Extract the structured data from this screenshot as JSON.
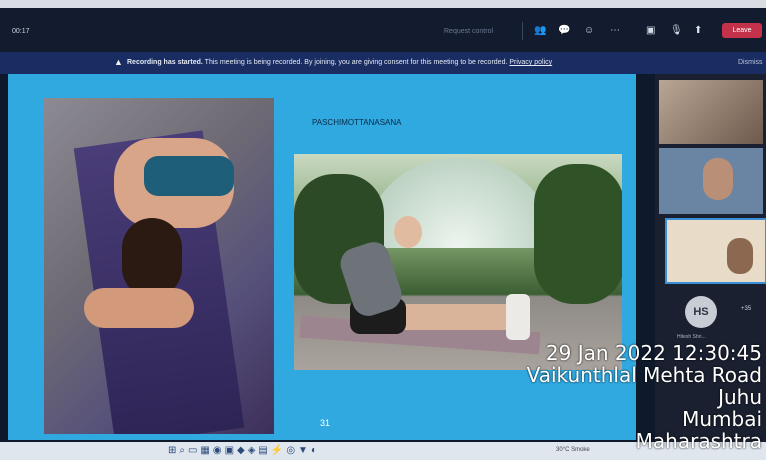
{
  "meeting": {
    "timer": "00:17",
    "request_control": "Request control",
    "leave": "Leave"
  },
  "banner": {
    "bold": "Recording has started.",
    "message": " This meeting is being recorded. By joining, you are giving consent for this meeting to be recorded. ",
    "privacy": "Privacy policy",
    "dismiss": "Dismiss"
  },
  "slide": {
    "title": "PASCHIMOTTANASANA",
    "page_number": "31"
  },
  "participants": {
    "avatar_initials": "HS",
    "avatar_name": "Hitesh Shri...",
    "overflow_count": "+35"
  },
  "taskbar": {
    "weather": "30°C Smoke"
  },
  "stamp": {
    "datetime": "29 Jan 2022 12:30:45",
    "line2": "Vaikunthlal Mehta Road",
    "line3": "Juhu",
    "line4": "Mumbai",
    "line5": "Maharashtra"
  },
  "colors": {
    "slide_bg": "#30a8e0",
    "leave_red": "#c4314b",
    "banner_bg": "#1a2d62"
  }
}
